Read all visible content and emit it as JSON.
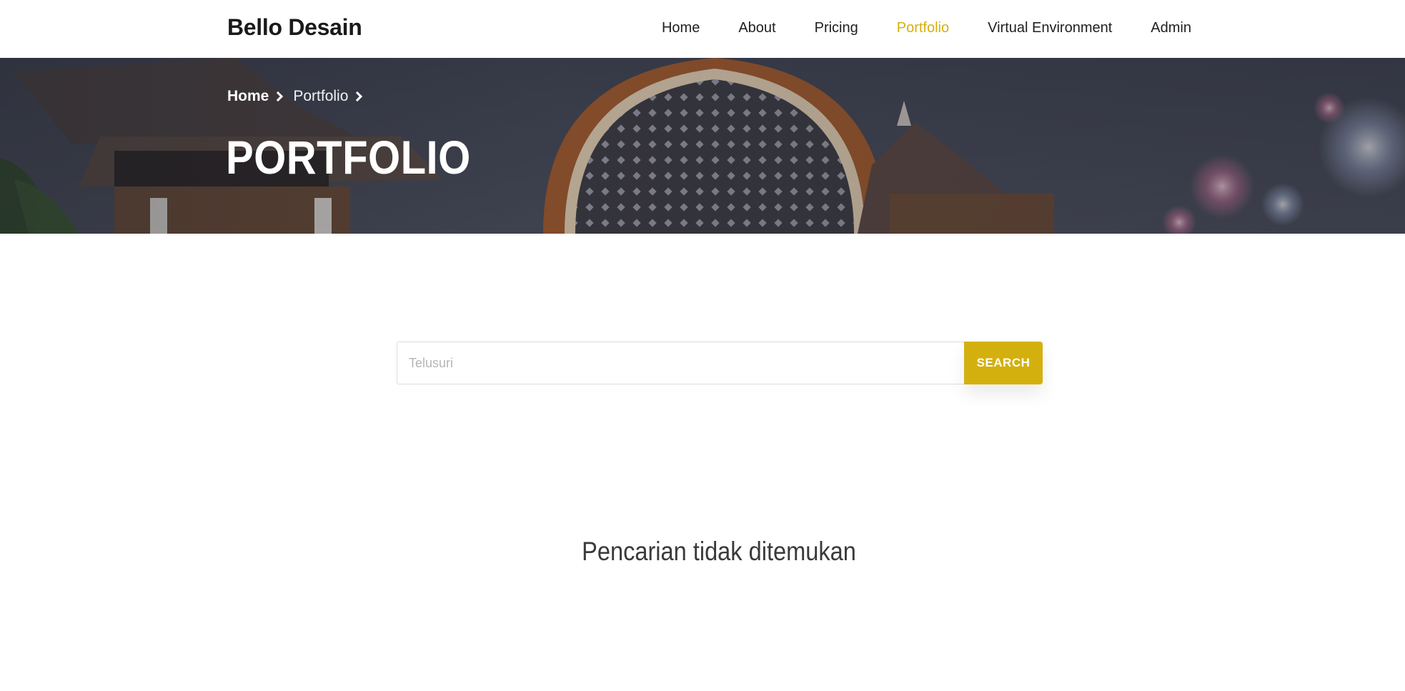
{
  "brand": {
    "name": "Bello Desain"
  },
  "nav": {
    "items": [
      {
        "label": "Home",
        "active": false
      },
      {
        "label": "About",
        "active": false
      },
      {
        "label": "Pricing",
        "active": false
      },
      {
        "label": "Portfolio",
        "active": true
      },
      {
        "label": "Virtual Environment",
        "active": false
      },
      {
        "label": "Admin",
        "active": false
      }
    ]
  },
  "hero": {
    "breadcrumb": [
      "Home",
      "Portfolio"
    ],
    "title": "PORTFOLIO"
  },
  "search": {
    "placeholder": "Telusuri",
    "value": "",
    "button_label": "SEARCH"
  },
  "results": {
    "empty_message": "Pencarian tidak ditemukan"
  },
  "colors": {
    "accent": "#d4b00f",
    "text": "#1f1f1f"
  }
}
